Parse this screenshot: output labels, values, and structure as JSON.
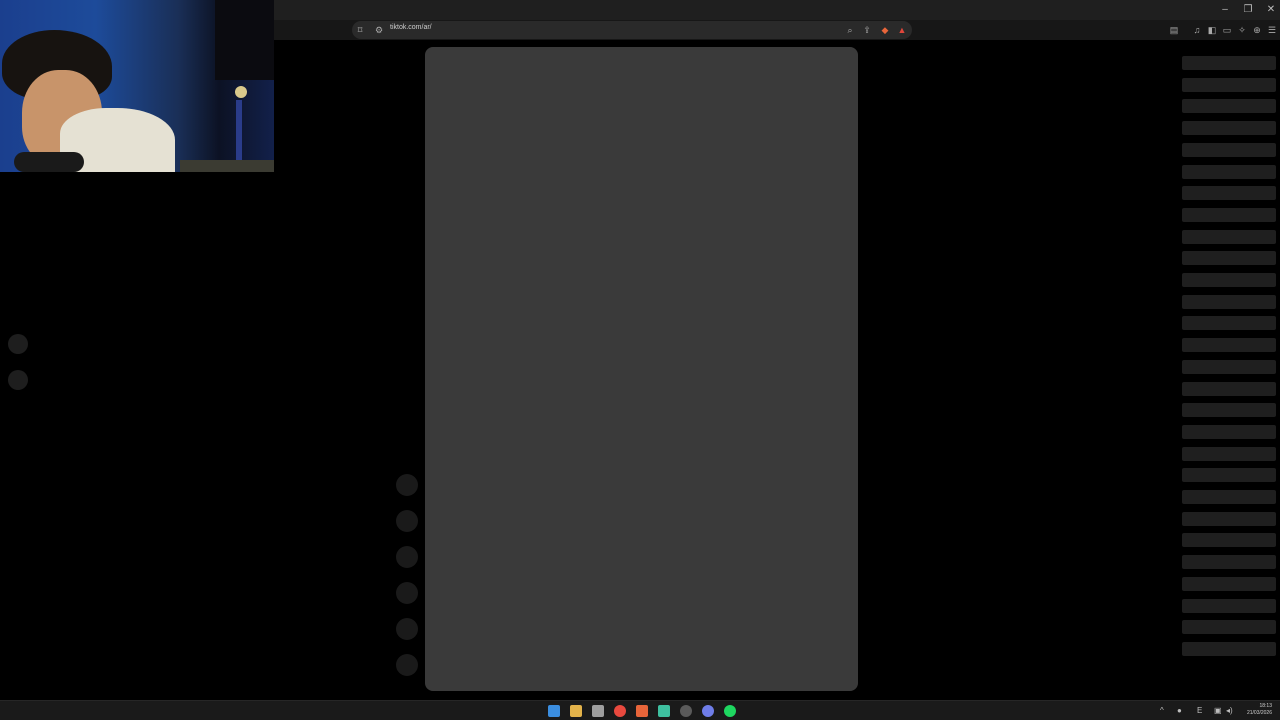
{
  "browser": {
    "url": "tiktok.com/ar/",
    "window_controls": {
      "minimize": "–",
      "restore": "❐",
      "close": "✕"
    },
    "icons": [
      "bookmark-icon",
      "site-info-icon",
      "zoom-icon",
      "share-icon",
      "brave-shields-icon",
      "brave-rewards-icon",
      "media-icon",
      "sidebar-icon",
      "wallet-icon",
      "extensions-icon",
      "vpn-icon",
      "menu-icon"
    ]
  },
  "webcam": {
    "subject": "streamer"
  },
  "page": {
    "left_nav_dots": 2,
    "action_buttons": 6,
    "comment_placeholders": 28,
    "video_card_color": "#3a3a3a"
  },
  "taskbar": {
    "apps": [
      "windows-start-icon",
      "file-explorer-icon",
      "store-icon",
      "chrome-icon",
      "brave-icon",
      "app-icon",
      "steam-icon",
      "discord-icon",
      "spotify-icon"
    ],
    "tray": {
      "chevron": "^",
      "lang": "E"
    },
    "clock": {
      "time": "18:13",
      "date": "21/03/2026"
    }
  }
}
